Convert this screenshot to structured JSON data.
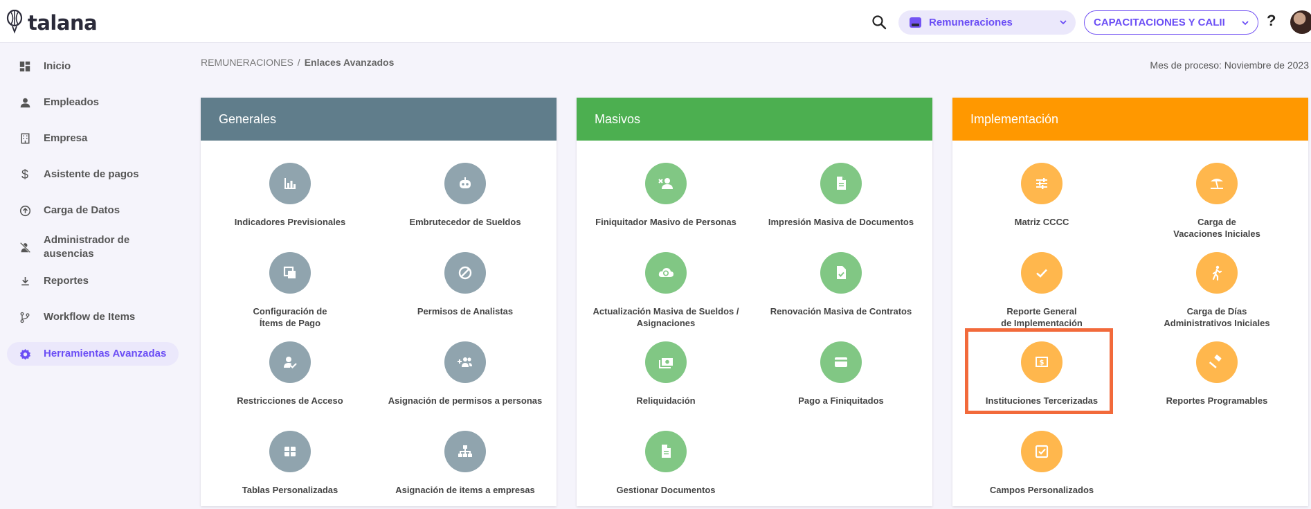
{
  "app": {
    "logo": "talana",
    "module_selector": "Remuneraciones",
    "company_selector": "CAPACITACIONES Y CALII",
    "help": "?"
  },
  "sidebar": {
    "items": [
      {
        "label": "Inicio",
        "icon": "dashboard-icon"
      },
      {
        "label": "Empleados",
        "icon": "person-icon"
      },
      {
        "label": "Empresa",
        "icon": "building-icon"
      },
      {
        "label": "Asistente de pagos",
        "icon": "dollar-icon"
      },
      {
        "label": "Carga de Datos",
        "icon": "upload-icon"
      },
      {
        "label": "Administrador de\nausencias",
        "icon": "person-off-icon"
      },
      {
        "label": "Reportes",
        "icon": "download-icon"
      },
      {
        "label": "Workflow de Items",
        "icon": "workflow-icon"
      },
      {
        "label": "Herramientas Avanzadas",
        "icon": "gear-icon",
        "active": true
      }
    ]
  },
  "breadcrumb": {
    "parent": "REMUNERACIONES",
    "separator": "/",
    "current": "Enlaces Avanzados"
  },
  "process_month": "Mes de proceso: Noviembre de 2023",
  "colors": {
    "generales": "#607d8b",
    "masivos": "#4caf50",
    "implementacion": "#ff9800",
    "accent": "#6b4ef5",
    "highlight": "#f26a3b"
  },
  "sections": [
    {
      "title": "Generales",
      "items": [
        {
          "label": "Indicadores Previsionales",
          "icon": "bar-chart-icon"
        },
        {
          "label": "Embrutecedor de Sueldos",
          "icon": "robot-icon"
        },
        {
          "label": "Configuración de\nÍtems de Pago",
          "icon": "copy-icon"
        },
        {
          "label": "Permisos de Analistas",
          "icon": "block-icon"
        },
        {
          "label": "Restricciones de Acceso",
          "icon": "person-check-icon"
        },
        {
          "label": "Asignación de permisos a personas",
          "icon": "group-add-icon"
        },
        {
          "label": "Tablas Personalizadas",
          "icon": "table-icon"
        },
        {
          "label": "Asignación de items a empresas",
          "icon": "sitemap-icon"
        }
      ]
    },
    {
      "title": "Masivos",
      "items": [
        {
          "label": "Finiquitador Masivo de Personas",
          "icon": "person-remove-icon"
        },
        {
          "label": "Impresión Masiva de Documentos",
          "icon": "document-icon"
        },
        {
          "label": "Actualización Masiva de Sueldos /\nAsignaciones",
          "icon": "cloud-sync-icon"
        },
        {
          "label": "Renovación Masiva de Contratos",
          "icon": "file-check-icon"
        },
        {
          "label": "Reliquidación",
          "icon": "money-icon"
        },
        {
          "label": "Pago a Finiquitados",
          "icon": "card-icon"
        },
        {
          "label": "Gestionar Documentos",
          "icon": "document-text-icon"
        }
      ]
    },
    {
      "title": "Implementación",
      "items": [
        {
          "label": "Matriz CCCC",
          "icon": "sliders-icon"
        },
        {
          "label": "Carga de\nVacaciones Iniciales",
          "icon": "beach-icon"
        },
        {
          "label": "Reporte General\nde Implementación",
          "icon": "check-icon"
        },
        {
          "label": "Carga de Días\nAdministrativos Iniciales",
          "icon": "walk-icon"
        },
        {
          "label": "Instituciones Tercerizadas",
          "icon": "dollar-bill-icon"
        },
        {
          "label": "Reportes Programables",
          "icon": "gavel-icon"
        },
        {
          "label": "Campos Personalizados",
          "icon": "checkbox-icon"
        }
      ]
    }
  ]
}
